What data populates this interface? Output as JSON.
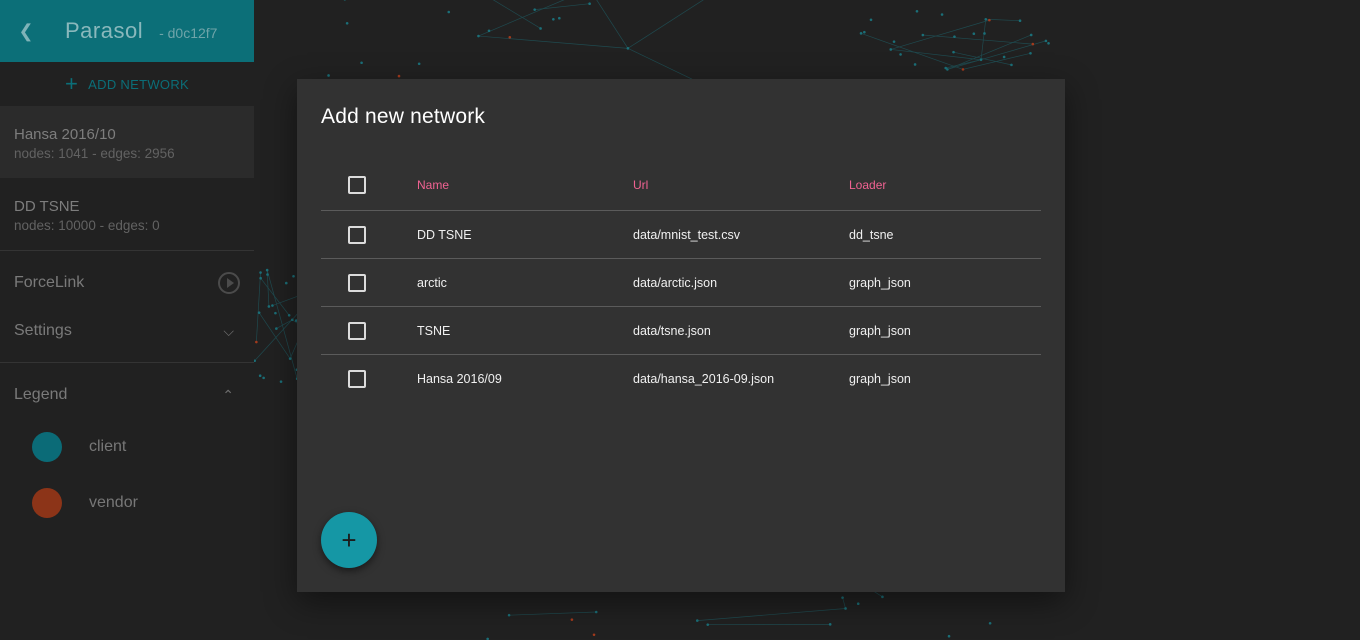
{
  "app": {
    "title": "Parasol",
    "hash": "- d0c12f7",
    "back_icon": "chevron-left-icon"
  },
  "sidebar": {
    "add_network_label": "ADD NETWORK",
    "networks": [
      {
        "name": "Hansa 2016/10",
        "meta": "nodes: 1041 - edges: 2956",
        "active": true
      },
      {
        "name": "DD TSNE",
        "meta": "nodes: 10000 - edges: 0",
        "active": false
      }
    ],
    "forcelink_label": "ForceLink",
    "settings_label": "Settings",
    "legend_label": "Legend",
    "legend_items": [
      {
        "label": "client",
        "color": "#0b6b77"
      },
      {
        "label": "vendor",
        "color": "#8c3418"
      }
    ]
  },
  "dialog": {
    "title": "Add new network",
    "columns": {
      "name": "Name",
      "url": "Url",
      "loader": "Loader"
    },
    "rows": [
      {
        "name": "DD TSNE",
        "url": "data/mnist_test.csv",
        "loader": "dd_tsne"
      },
      {
        "name": "arctic",
        "url": "data/arctic.json",
        "loader": "graph_json"
      },
      {
        "name": "TSNE",
        "url": "data/tsne.json",
        "loader": "graph_json"
      },
      {
        "name": "Hansa 2016/09",
        "url": "data/hansa_2016-09.json",
        "loader": "graph_json"
      }
    ],
    "fab_icon": "plus-icon"
  },
  "colors": {
    "header_bg": "#0c6f78",
    "accent": "#1597a5",
    "column_header": "#f06292",
    "dialog_bg": "#323232"
  }
}
